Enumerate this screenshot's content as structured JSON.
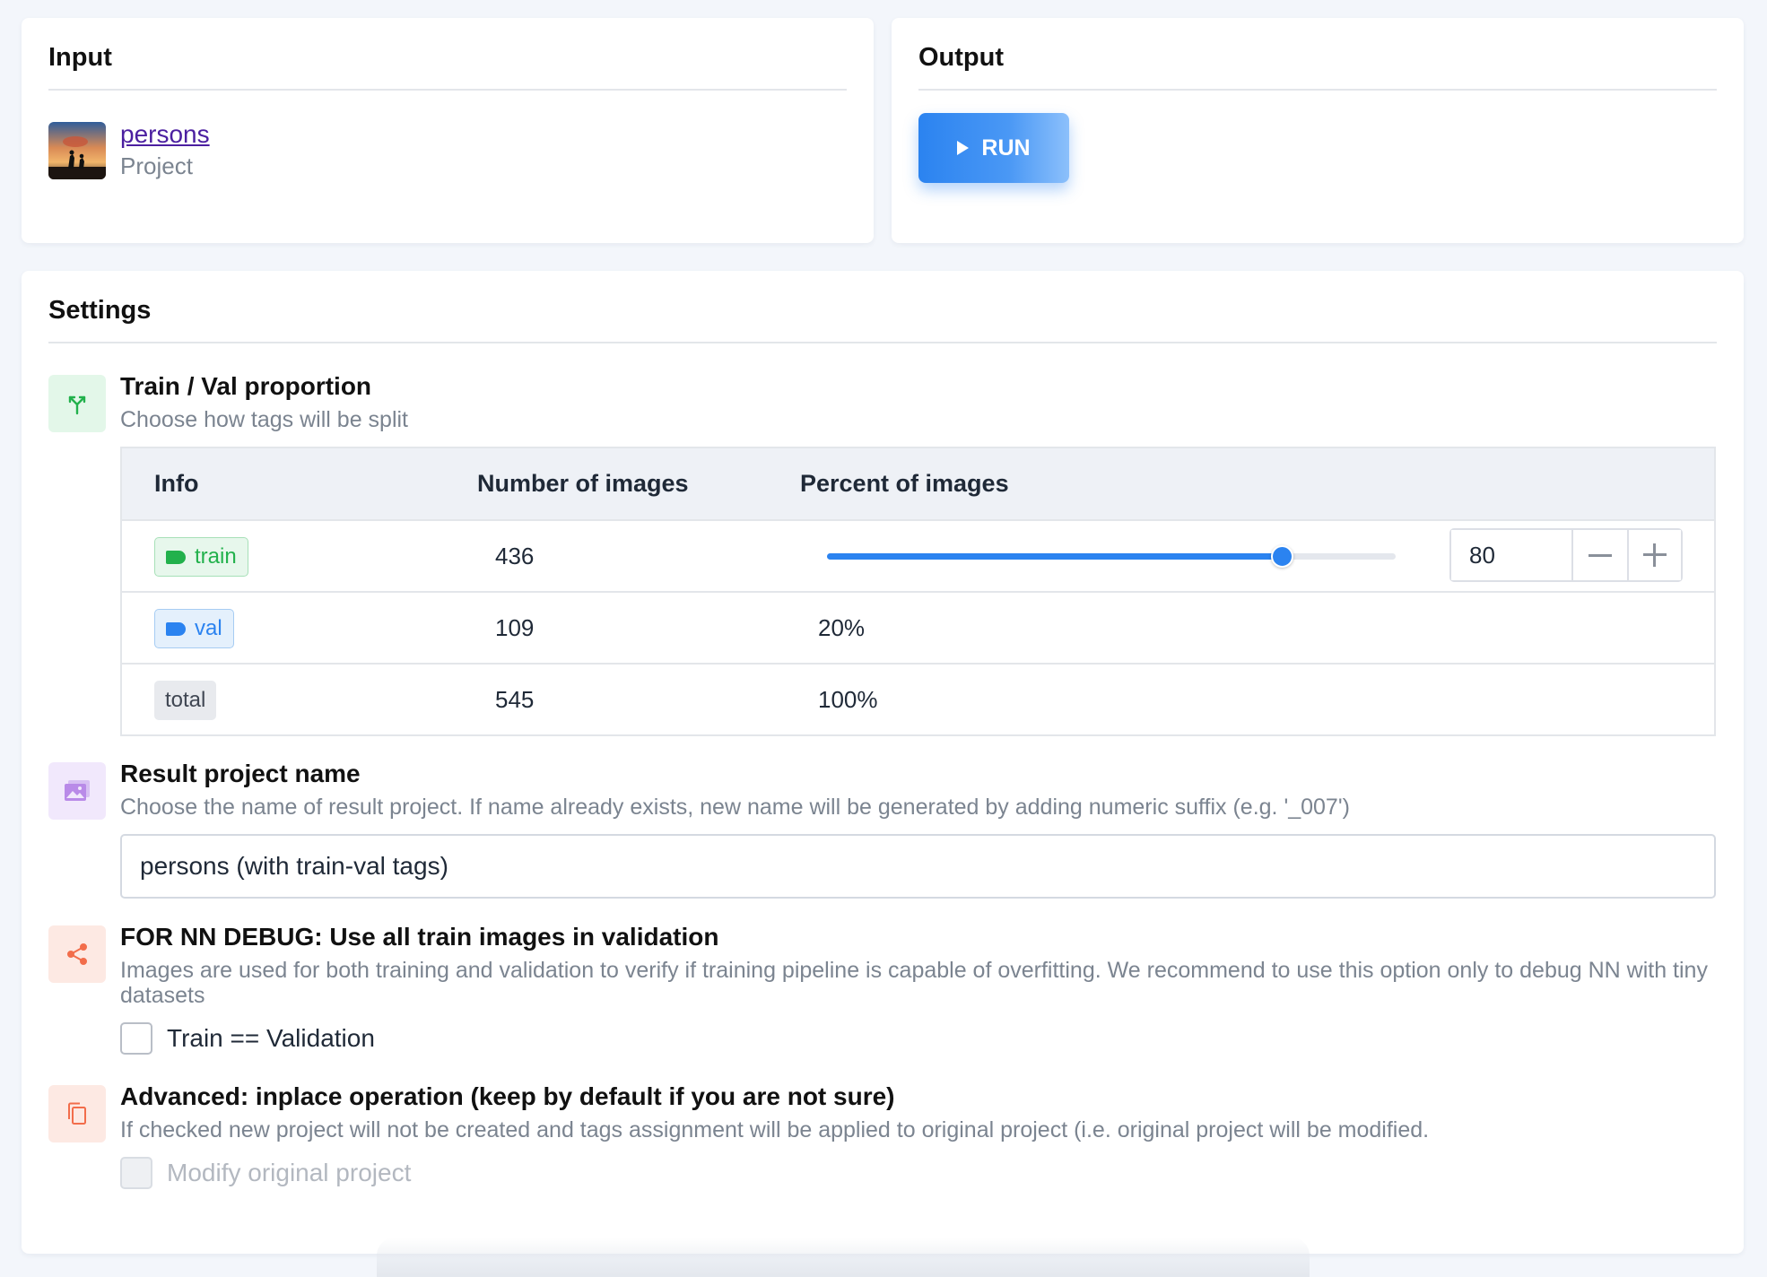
{
  "input": {
    "title": "Input",
    "project_name": "persons",
    "project_type": "Project"
  },
  "output": {
    "title": "Output",
    "run_label": "RUN"
  },
  "settings": {
    "title": "Settings",
    "split": {
      "title": "Train / Val proportion",
      "description": "Choose how tags will be split",
      "headers": [
        "Info",
        "Number of images",
        "Percent of images"
      ],
      "rows": {
        "train": {
          "tag": "train",
          "count": "436",
          "percent": 80
        },
        "val": {
          "tag": "val",
          "count": "109",
          "percent": "20%"
        },
        "total": {
          "tag": "total",
          "count": "545",
          "percent": "100%"
        }
      },
      "slider_value_fraction": 0.8,
      "stepper_value": "80"
    },
    "result_name": {
      "title": "Result project name",
      "description": "Choose the name of result project. If name already exists, new name will be generated by adding numeric suffix (e.g. '_007')",
      "value": "persons (with train-val tags)"
    },
    "debug": {
      "title": "FOR NN DEBUG: Use all train images in validation",
      "description": "Images are used for both training and validation to verify if training pipeline is capable of overfitting. We recommend to use this option only to debug NN with tiny datasets",
      "checkbox_label": "Train == Validation",
      "checked": false
    },
    "inplace": {
      "title": "Advanced: inplace operation (keep by default if you are not sure)",
      "description": "If checked new project will not be created and tags assignment will be applied to original project (i.e. original project will be modified.",
      "checkbox_label": "Modify original project",
      "checked": false,
      "disabled": true
    }
  },
  "colors": {
    "accent": "#2b83f0",
    "train_green": "#22b14c",
    "val_blue": "#2b83f0",
    "debug_orange": "#f26d4b"
  },
  "icons": {
    "split": "split-arrows-icon",
    "result": "image-gallery-icon",
    "debug": "share-icon",
    "inplace": "copy-icon"
  }
}
